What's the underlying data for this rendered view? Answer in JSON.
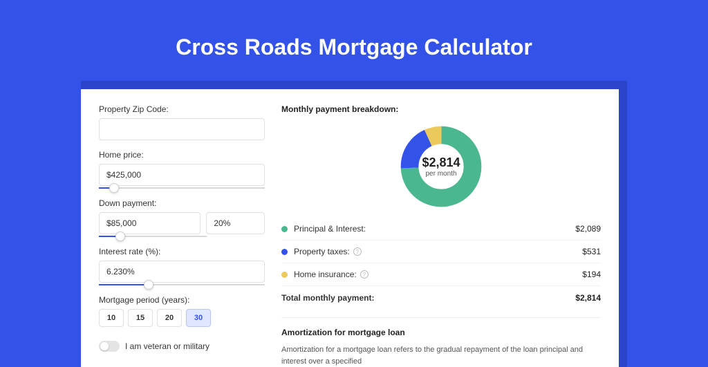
{
  "page": {
    "title": "Cross Roads Mortgage Calculator"
  },
  "form": {
    "zip_label": "Property Zip Code:",
    "zip_value": "",
    "home_price_label": "Home price:",
    "home_price_value": "$425,000",
    "home_price_slider_pct": 9,
    "down_payment_label": "Down payment:",
    "down_payment_value": "$85,000",
    "down_payment_pct_value": "20%",
    "down_payment_slider_pct": 20,
    "interest_label": "Interest rate (%):",
    "interest_value": "6.230%",
    "interest_slider_pct": 30,
    "period_label": "Mortgage period (years):",
    "periods": [
      {
        "label": "10",
        "active": false
      },
      {
        "label": "15",
        "active": false
      },
      {
        "label": "20",
        "active": false
      },
      {
        "label": "30",
        "active": true
      }
    ],
    "veteran_label": "I am veteran or military",
    "veteran_on": false
  },
  "breakdown": {
    "title": "Monthly payment breakdown:",
    "total_amount": "$2,814",
    "total_sub": "per month",
    "items": [
      {
        "label": "Principal & Interest:",
        "value": "$2,089",
        "color": "#4bb78f",
        "help": false
      },
      {
        "label": "Property taxes:",
        "value": "$531",
        "color": "#3353e8",
        "help": true
      },
      {
        "label": "Home insurance:",
        "value": "$194",
        "color": "#ebc95a",
        "help": true
      }
    ],
    "total_row_label": "Total monthly payment:",
    "total_row_value": "$2,814"
  },
  "amortization": {
    "title": "Amortization for mortgage loan",
    "text": "Amortization for a mortgage loan refers to the gradual repayment of the loan principal and interest over a specified"
  },
  "chart_data": {
    "type": "pie",
    "title": "Monthly payment breakdown",
    "series": [
      {
        "name": "Principal & Interest",
        "value": 2089,
        "color": "#4bb78f"
      },
      {
        "name": "Property taxes",
        "value": 531,
        "color": "#3353e8"
      },
      {
        "name": "Home insurance",
        "value": 194,
        "color": "#ebc95a"
      }
    ],
    "total": 2814,
    "center_label": "$2,814",
    "center_sub": "per month"
  }
}
